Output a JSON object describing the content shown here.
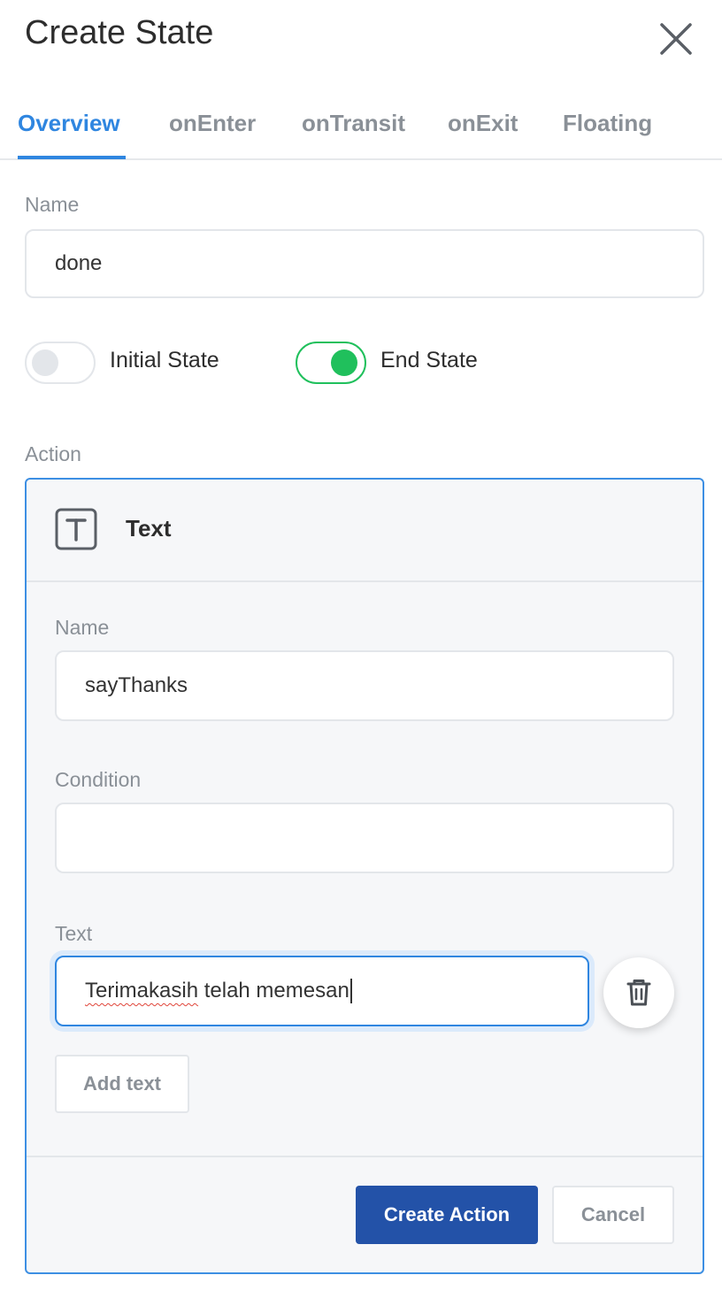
{
  "header": {
    "title": "Create State",
    "close_icon": "close-icon"
  },
  "tabs": [
    {
      "label": "Overview",
      "active": true
    },
    {
      "label": "onEnter",
      "active": false
    },
    {
      "label": "onTransit",
      "active": false
    },
    {
      "label": "onExit",
      "active": false
    },
    {
      "label": "Floating",
      "active": false
    }
  ],
  "state": {
    "name_label": "Name",
    "name_value": "done",
    "initial_state_label": "Initial State",
    "initial_state_on": false,
    "end_state_label": "End State",
    "end_state_on": true
  },
  "action": {
    "section_label": "Action",
    "type_icon": "text-icon",
    "type_label": "Text",
    "name_label": "Name",
    "name_value": "sayThanks",
    "condition_label": "Condition",
    "condition_value": "",
    "text_label": "Text",
    "text_value_misspelled": "Terimakasih",
    "text_value_rest": " telah memesan",
    "delete_icon": "trash-icon",
    "add_text_label": "Add text",
    "create_label": "Create Action",
    "cancel_label": "Cancel"
  },
  "colors": {
    "accent": "#2f86e0",
    "toggle_on": "#20c05c",
    "primary_button": "#2352a8",
    "muted_text": "#8a9097"
  }
}
